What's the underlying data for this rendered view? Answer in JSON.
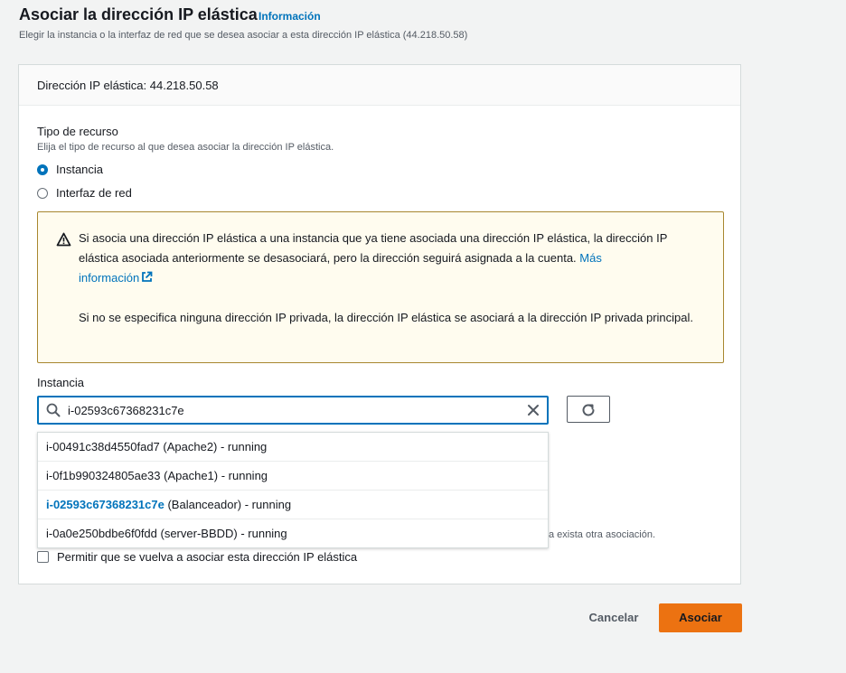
{
  "header": {
    "title": "Asociar la dirección IP elástica",
    "info_link": "Información",
    "description": "Elegir la instancia o la interfaz de red que se desea asociar a esta dirección IP elástica (44.218.50.58)"
  },
  "panel": {
    "header_text": "Dirección IP elástica: 44.218.50.58",
    "resource_type": {
      "label": "Tipo de recurso",
      "description": "Elija el tipo de recurso al que desea asociar la dirección IP elástica.",
      "options": [
        {
          "label": "Instancia",
          "selected": true
        },
        {
          "label": "Interfaz de red",
          "selected": false
        }
      ]
    },
    "alert": {
      "text_main": "Si asocia una dirección IP elástica a una instancia que ya tiene asociada una dirección IP elástica, la dirección IP elástica asociada anteriormente se desasociará, pero la dirección seguirá asignada a la cuenta.",
      "link_part1": "Más",
      "link_part2": "información",
      "text_secondary": "Si no se especifica ninguna dirección IP privada, la dirección IP elástica se asociará a la dirección IP privada principal."
    },
    "instance": {
      "label": "Instancia",
      "search_value": "i-02593c67368231c7e",
      "options": [
        {
          "id": "i-00491c38d4550fad7",
          "rest": " (Apache2) - running",
          "highlight": false
        },
        {
          "id": "i-0f1b990324805ae33",
          "rest": " (Apache1) - running",
          "highlight": false
        },
        {
          "id": "i-02593c67368231c7e",
          "rest": " (Balanceador) - running",
          "highlight": true
        },
        {
          "id": "i-0a0e250bdbe6f0fdd",
          "rest": " (server-BBDD) - running",
          "highlight": false
        }
      ]
    },
    "partial_hint": "a exista otra asociación.",
    "reassociate_label": "Permitir que se vuelva a asociar esta dirección IP elástica",
    "reassociate_checked": false
  },
  "footer": {
    "cancel_label": "Cancelar",
    "submit_label": "Asociar"
  },
  "colors": {
    "link": "#0073bb",
    "primary_button": "#ec7211",
    "alert_bg": "#fffcef",
    "alert_border": "#a8872f"
  }
}
